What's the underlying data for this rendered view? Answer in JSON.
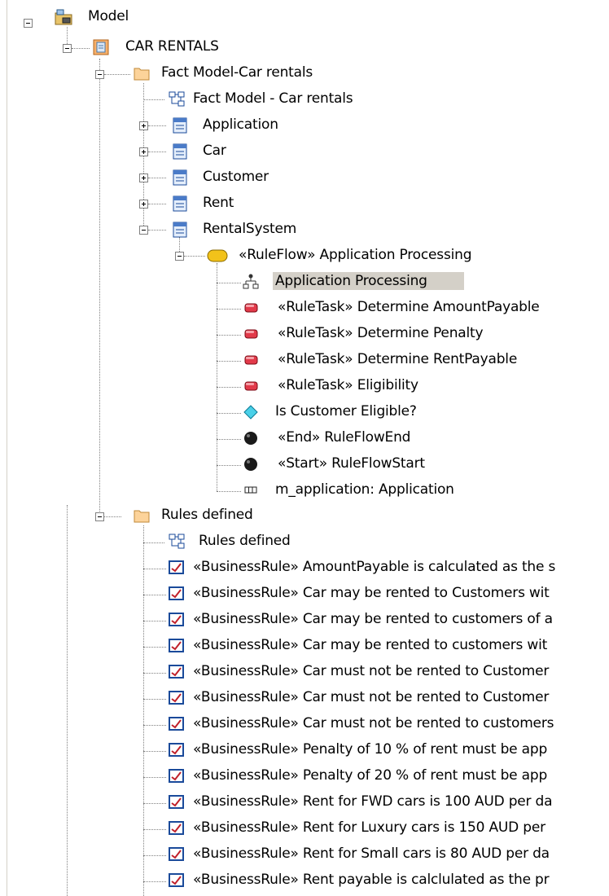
{
  "tree": {
    "model": "Model",
    "package": "CAR RENTALS",
    "fact_folder": "Fact Model-Car rentals",
    "fact_diagram": "Fact Model - Car rentals",
    "classes": [
      "Application",
      "Car",
      "Customer",
      "Rent",
      "RentalSystem"
    ],
    "ruleflow": "«RuleFlow» Application Processing",
    "ruleflow_children": [
      "Application Processing",
      "«RuleTask» Determine AmountPayable",
      "«RuleTask» Determine Penalty",
      "«RuleTask» Determine RentPayable",
      "«RuleTask» Eligibility",
      "Is Customer Eligible?",
      "«End» RuleFlowEnd",
      "«Start» RuleFlowStart",
      "m_application: Application"
    ],
    "rules_folder": "Rules defined",
    "rules_diagram": "Rules defined",
    "rules": [
      "«BusinessRule» AmountPayable is calculated as the s",
      "«BusinessRule» Car may be rented to Customers wit",
      "«BusinessRule» Car may be rented to customers of a",
      "«BusinessRule» Car may be rented to customers wit",
      "«BusinessRule» Car must not be rented to Customer",
      "«BusinessRule» Car must not be rented to Customer",
      "«BusinessRule» Car must not be rented to customers",
      "«BusinessRule» Penalty of 10 % of rent must be app",
      "«BusinessRule» Penalty of 20 % of rent must be app",
      "«BusinessRule» Rent for FWD cars is 100 AUD per da",
      "«BusinessRule» Rent for Luxury cars is 150 AUD per",
      "«BusinessRule» Rent for Small cars is 80 AUD per da",
      "«BusinessRule» Rent payable is calclulated as the pr"
    ]
  }
}
